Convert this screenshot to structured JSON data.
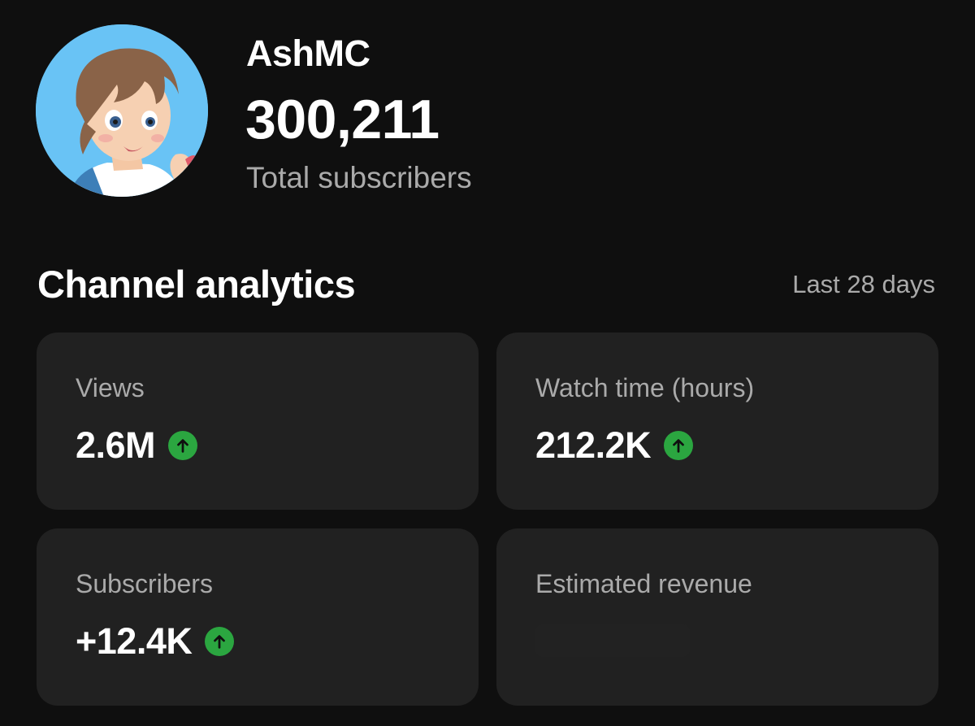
{
  "channel": {
    "name": "AshMC",
    "subscriber_count": "300,211",
    "subscriber_label": "Total subscribers"
  },
  "analytics": {
    "title": "Channel analytics",
    "period": "Last 28 days",
    "cards": [
      {
        "label": "Views",
        "value": "2.6M",
        "trend": "up"
      },
      {
        "label": "Watch time (hours)",
        "value": "212.2K",
        "trend": "up"
      },
      {
        "label": "Subscribers",
        "value": "+12.4K",
        "trend": "up"
      },
      {
        "label": "Estimated revenue",
        "value": null,
        "trend": null
      }
    ]
  },
  "icons": {
    "trend_up": "arrow-up-circle-icon"
  },
  "colors": {
    "background": "#0f0f0f",
    "card": "#212121",
    "trend_up": "#2ba640",
    "avatar_bg": "#69c3f5"
  }
}
